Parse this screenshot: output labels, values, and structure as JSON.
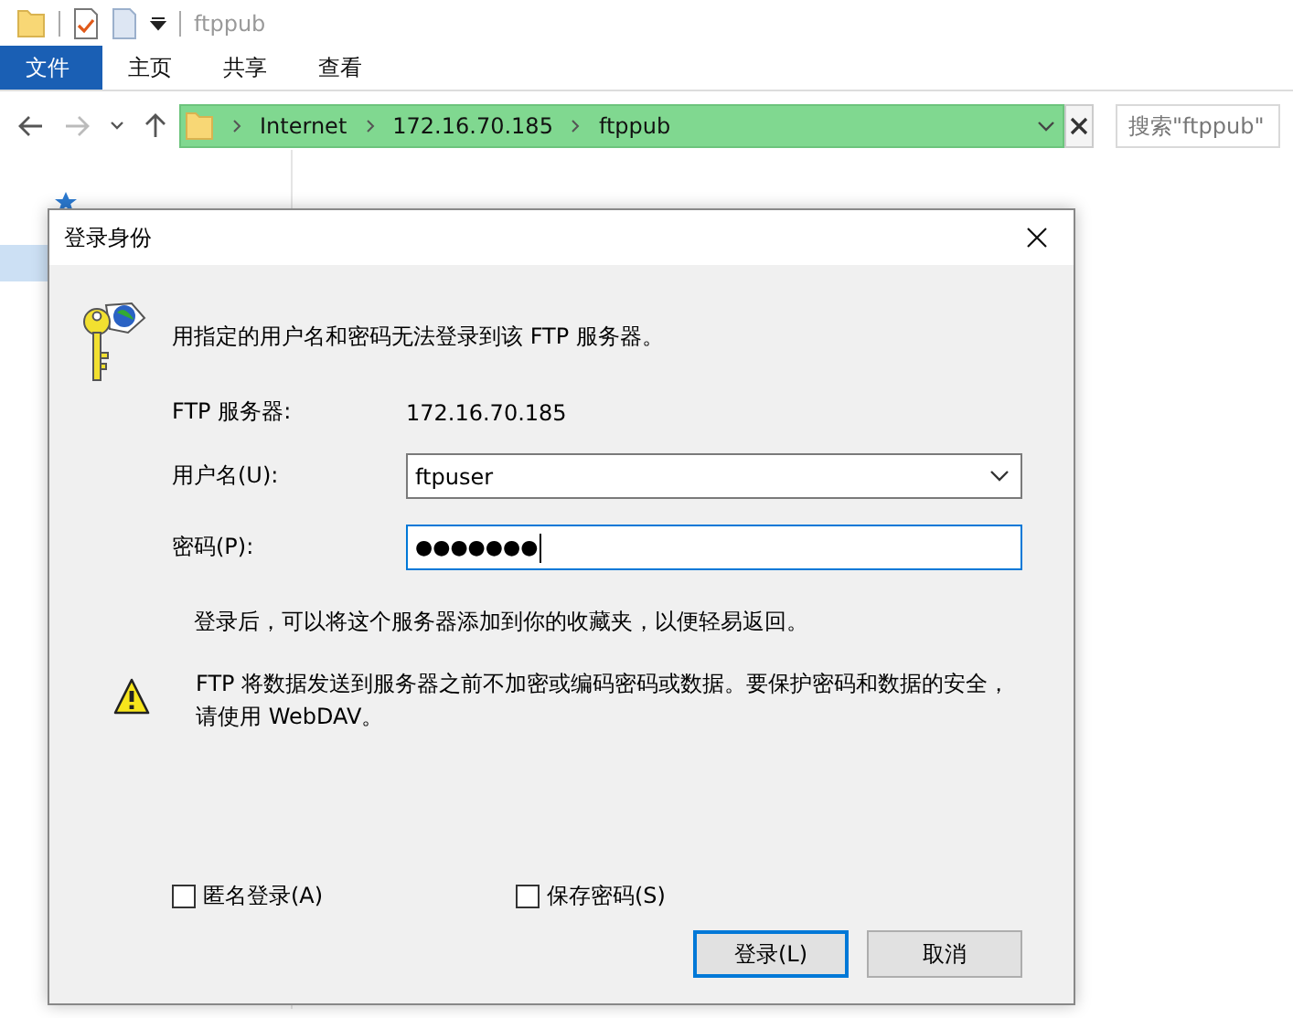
{
  "explorer": {
    "window_title": "ftppub",
    "ribbon_tabs": [
      {
        "label": "文件",
        "selected": true
      },
      {
        "label": "主页",
        "selected": false
      },
      {
        "label": "共享",
        "selected": false
      },
      {
        "label": "查看",
        "selected": false
      }
    ],
    "breadcrumbs": [
      "Internet",
      "172.16.70.185",
      "ftppub"
    ],
    "search": {
      "placeholder": "搜索\"ftppub\""
    }
  },
  "dialog": {
    "title": "登录身份",
    "message": "用指定的用户名和密码无法登录到该 FTP 服务器。",
    "server_label": "FTP 服务器:",
    "server_value": "172.16.70.185",
    "username": {
      "label": "用户名(U):",
      "value": "ftpuser"
    },
    "password": {
      "label": "密码(P):",
      "value": "●●●●●●●",
      "focused": true
    },
    "info": "登录后，可以将这个服务器添加到你的收藏夹，以便轻易返回。",
    "warning": "FTP 将数据发送到服务器之前不加密或编码密码或数据。要保护密码和数据的安全，请使用 WebDAV。",
    "checkboxes": [
      {
        "label": "匿名登录(A)",
        "checked": false
      },
      {
        "label": "保存密码(S)",
        "checked": false
      }
    ],
    "buttons": [
      {
        "label": "登录(L)",
        "kind": "default"
      },
      {
        "label": "取消",
        "kind": "normal"
      }
    ]
  }
}
